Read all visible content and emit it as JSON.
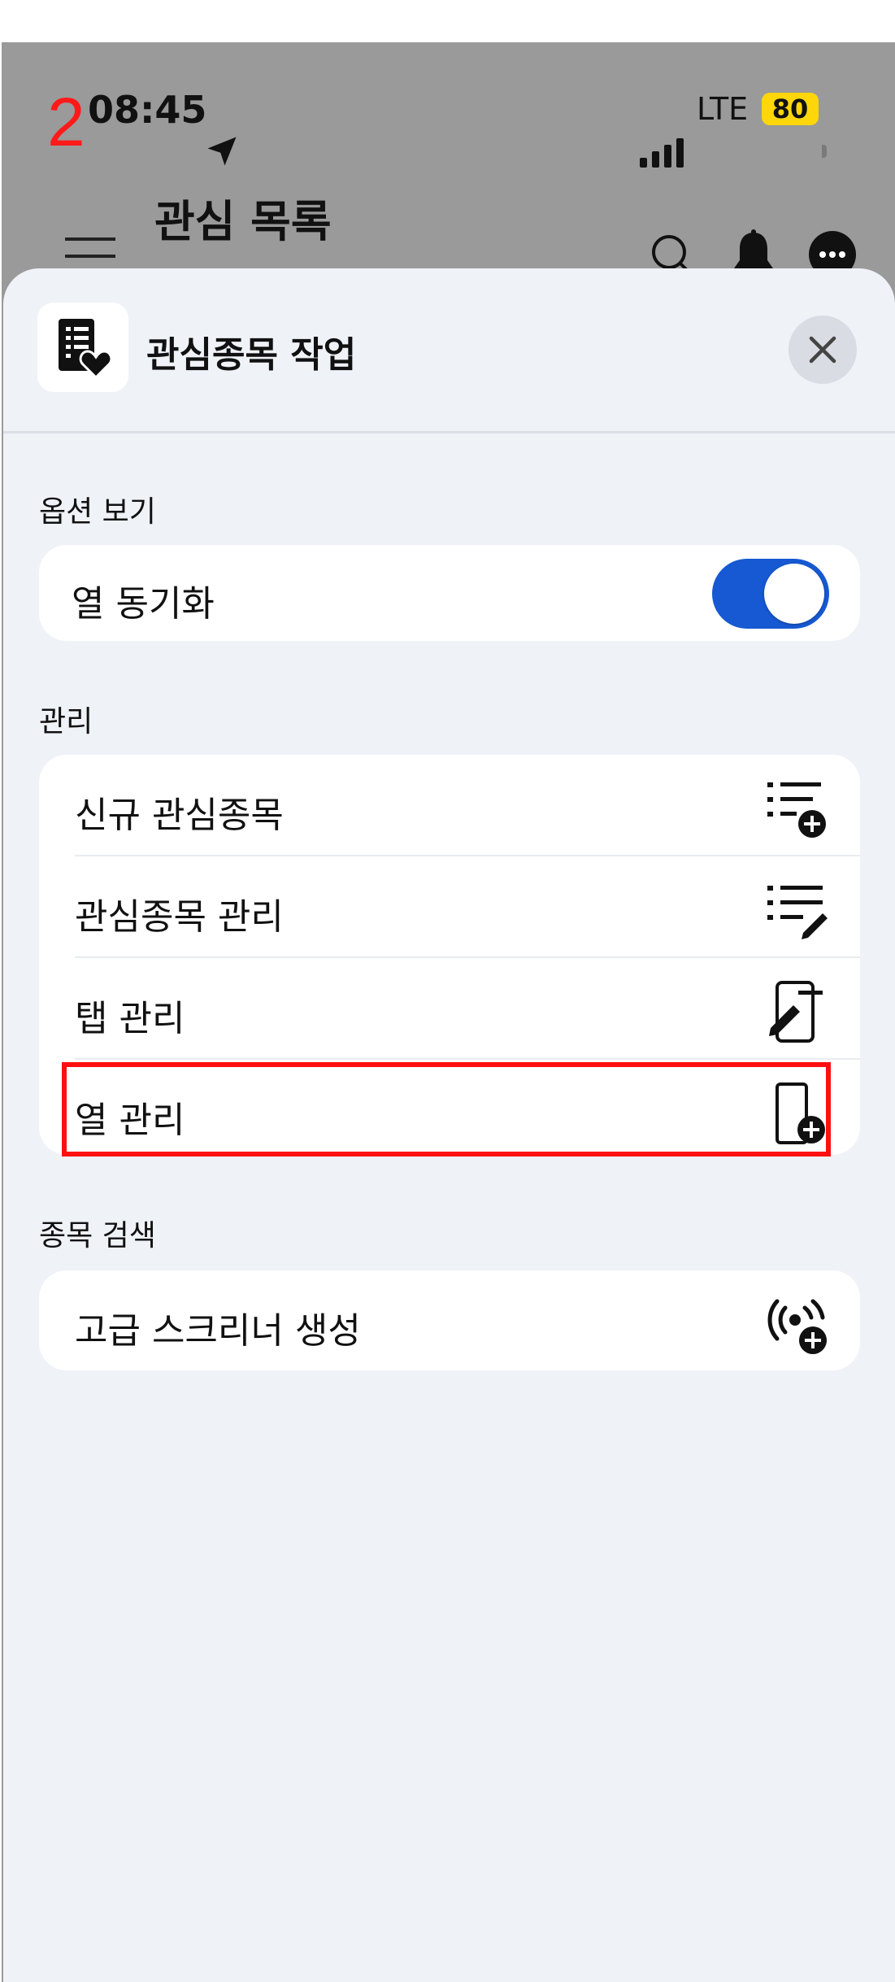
{
  "annotation": {
    "step_number": "2"
  },
  "status_bar": {
    "time": "08:45",
    "network": "LTE",
    "battery": "80"
  },
  "app_bar": {
    "title": "관심 목록"
  },
  "sheet": {
    "title": "관심종목 작업"
  },
  "sections": {
    "view_options": {
      "label": "옵션 보기",
      "items": [
        {
          "label": "열 동기화",
          "toggle_on": true
        }
      ]
    },
    "manage": {
      "label": "관리",
      "items": [
        {
          "label": "신규 관심종목",
          "icon": "list-add-icon"
        },
        {
          "label": "관심종목 관리",
          "icon": "list-edit-icon"
        },
        {
          "label": "탭 관리",
          "icon": "tab-edit-icon"
        },
        {
          "label": "열 관리",
          "icon": "column-add-icon"
        }
      ]
    },
    "symbol_search": {
      "label": "종목 검색",
      "items": [
        {
          "label": "고급 스크리너 생성",
          "icon": "screener-add-icon"
        }
      ]
    }
  },
  "colors": {
    "toggle": "#1659d2",
    "highlight": "#ff1010",
    "battery": "#ffd60a"
  }
}
